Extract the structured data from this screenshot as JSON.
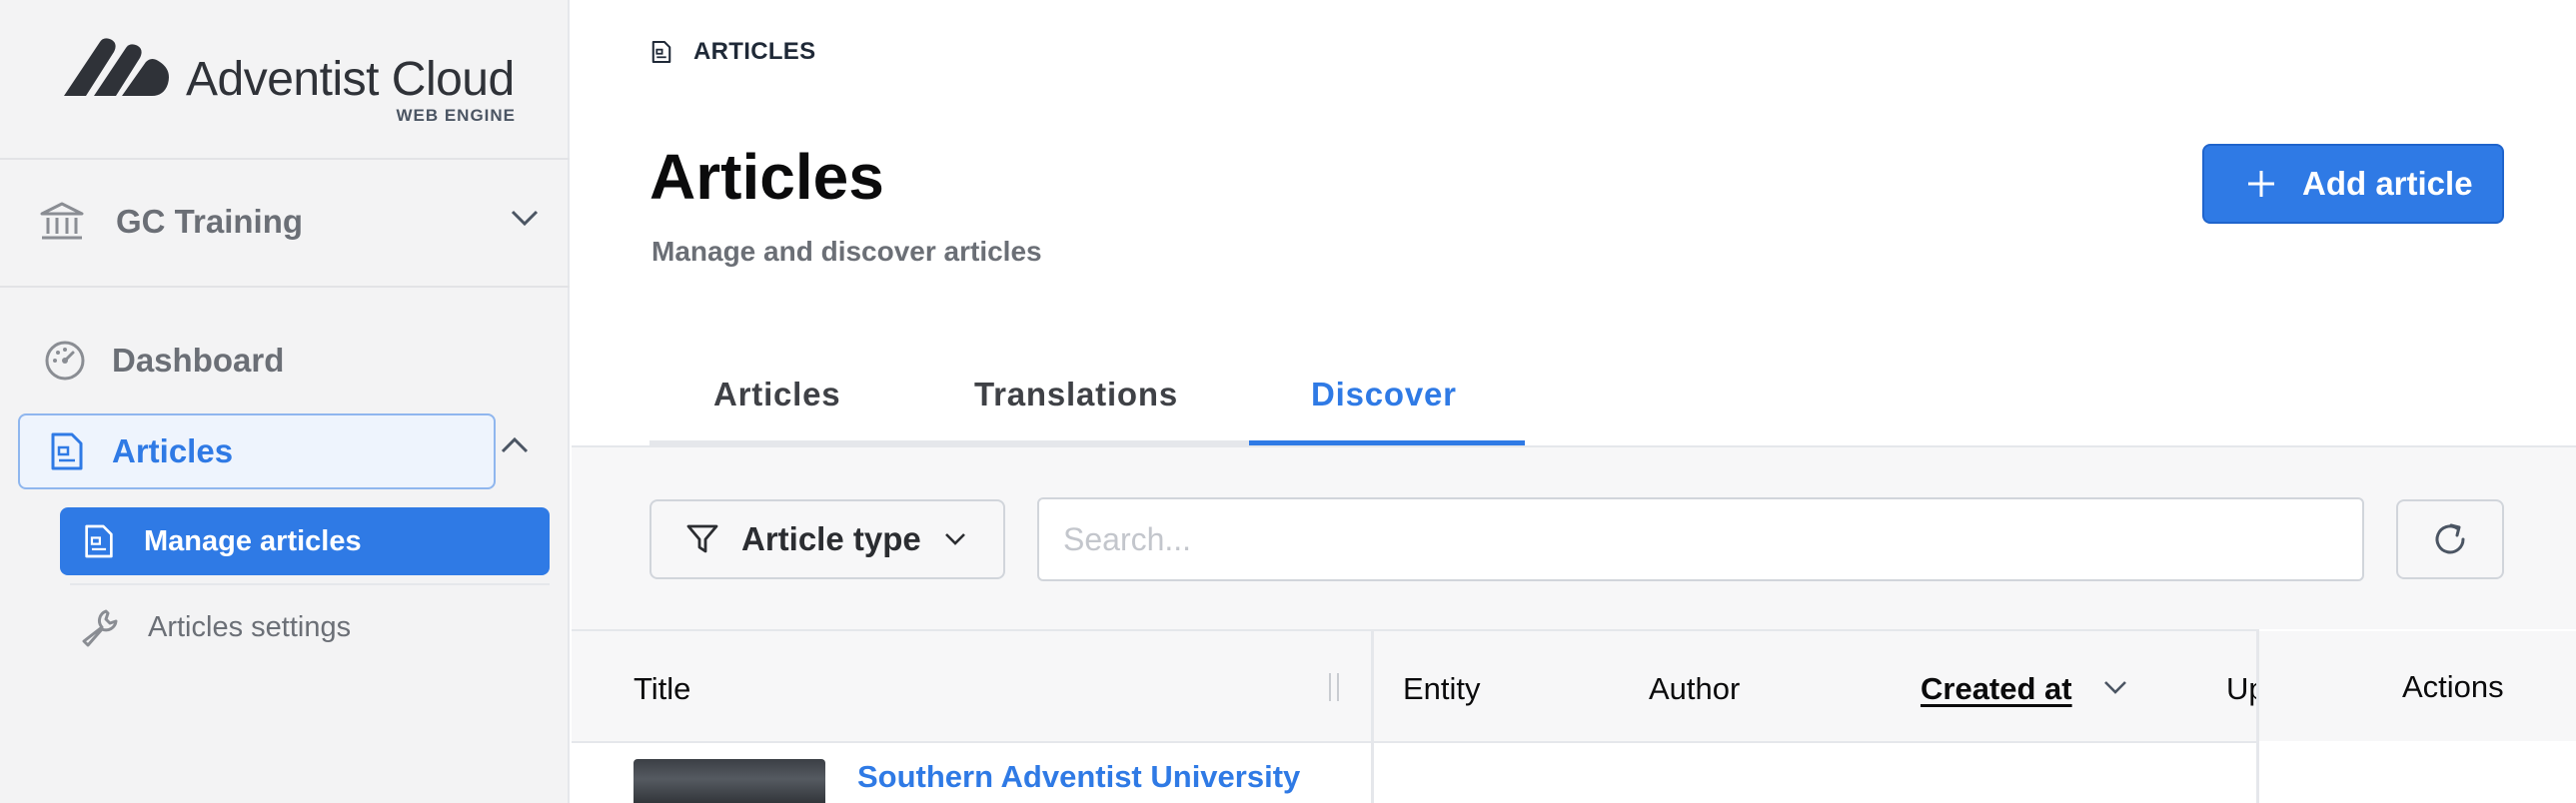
{
  "brand": {
    "name": "Adventist Cloud",
    "tagline": "WEB ENGINE"
  },
  "sidebar": {
    "site": {
      "label": "GC Training",
      "icon": "institution-icon"
    },
    "items": [
      {
        "label": "Dashboard",
        "icon": "gauge-icon"
      },
      {
        "label": "Articles",
        "icon": "document-icon",
        "expanded": true
      }
    ],
    "sub_items": [
      {
        "label": "Manage articles",
        "icon": "document-icon",
        "active": true
      },
      {
        "label": "Articles settings",
        "icon": "wrench-icon"
      }
    ]
  },
  "header": {
    "breadcrumb": "ARTICLES",
    "title": "Articles",
    "subtitle": "Manage and discover articles",
    "add_button": "Add article"
  },
  "tabs": [
    {
      "label": "Articles"
    },
    {
      "label": "Translations"
    },
    {
      "label": "Discover",
      "active": true
    }
  ],
  "filters": {
    "type_label": "Article type",
    "search_placeholder": "Search..."
  },
  "table": {
    "columns": [
      "Title",
      "Entity",
      "Author",
      "Created at",
      "Up",
      "Actions"
    ],
    "sorted_column": "Created at",
    "rows": [
      {
        "title": "Southern Adventist University"
      }
    ]
  },
  "colors": {
    "accent": "#2f7ae5",
    "sidebar_bg": "#f3f3f4"
  }
}
